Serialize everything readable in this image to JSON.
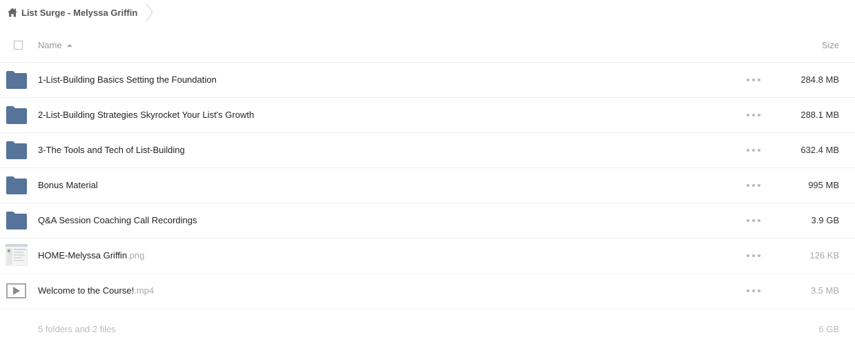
{
  "breadcrumb": {
    "home_icon": "home-icon",
    "label": "List Surge - Melyssa Griffin"
  },
  "header": {
    "name_label": "Name",
    "size_label": "Size",
    "sort_icon": "sort-ascending-icon"
  },
  "items": [
    {
      "type": "folder",
      "icon": "folder-icon",
      "name": "1-List-Building Basics Setting the Foundation",
      "ext": "",
      "size": "284.8 MB"
    },
    {
      "type": "folder",
      "icon": "folder-icon",
      "name": "2-List-Building Strategies Skyrocket Your List's Growth",
      "ext": "",
      "size": "288.1 MB"
    },
    {
      "type": "folder",
      "icon": "folder-icon",
      "name": "3-The Tools and Tech of List-Building",
      "ext": "",
      "size": "632.4 MB"
    },
    {
      "type": "folder",
      "icon": "folder-icon",
      "name": "Bonus Material",
      "ext": "",
      "size": "995 MB"
    },
    {
      "type": "folder",
      "icon": "folder-icon",
      "name": "Q&A Session Coaching Call Recordings",
      "ext": "",
      "size": "3.9 GB"
    },
    {
      "type": "image",
      "icon": "image-thumbnail-icon",
      "name": "HOME-Melyssa Griffin",
      "ext": ".png",
      "size": "126 KB"
    },
    {
      "type": "video",
      "icon": "video-play-icon",
      "name": "Welcome to the Course!",
      "ext": ".mp4",
      "size": "3.5 MB"
    }
  ],
  "summary": {
    "text": "5 folders and 2 files",
    "total_size": "6 GB"
  },
  "colors": {
    "folder": "#56739a",
    "text": "#222222",
    "muted": "#aaaaaa"
  }
}
